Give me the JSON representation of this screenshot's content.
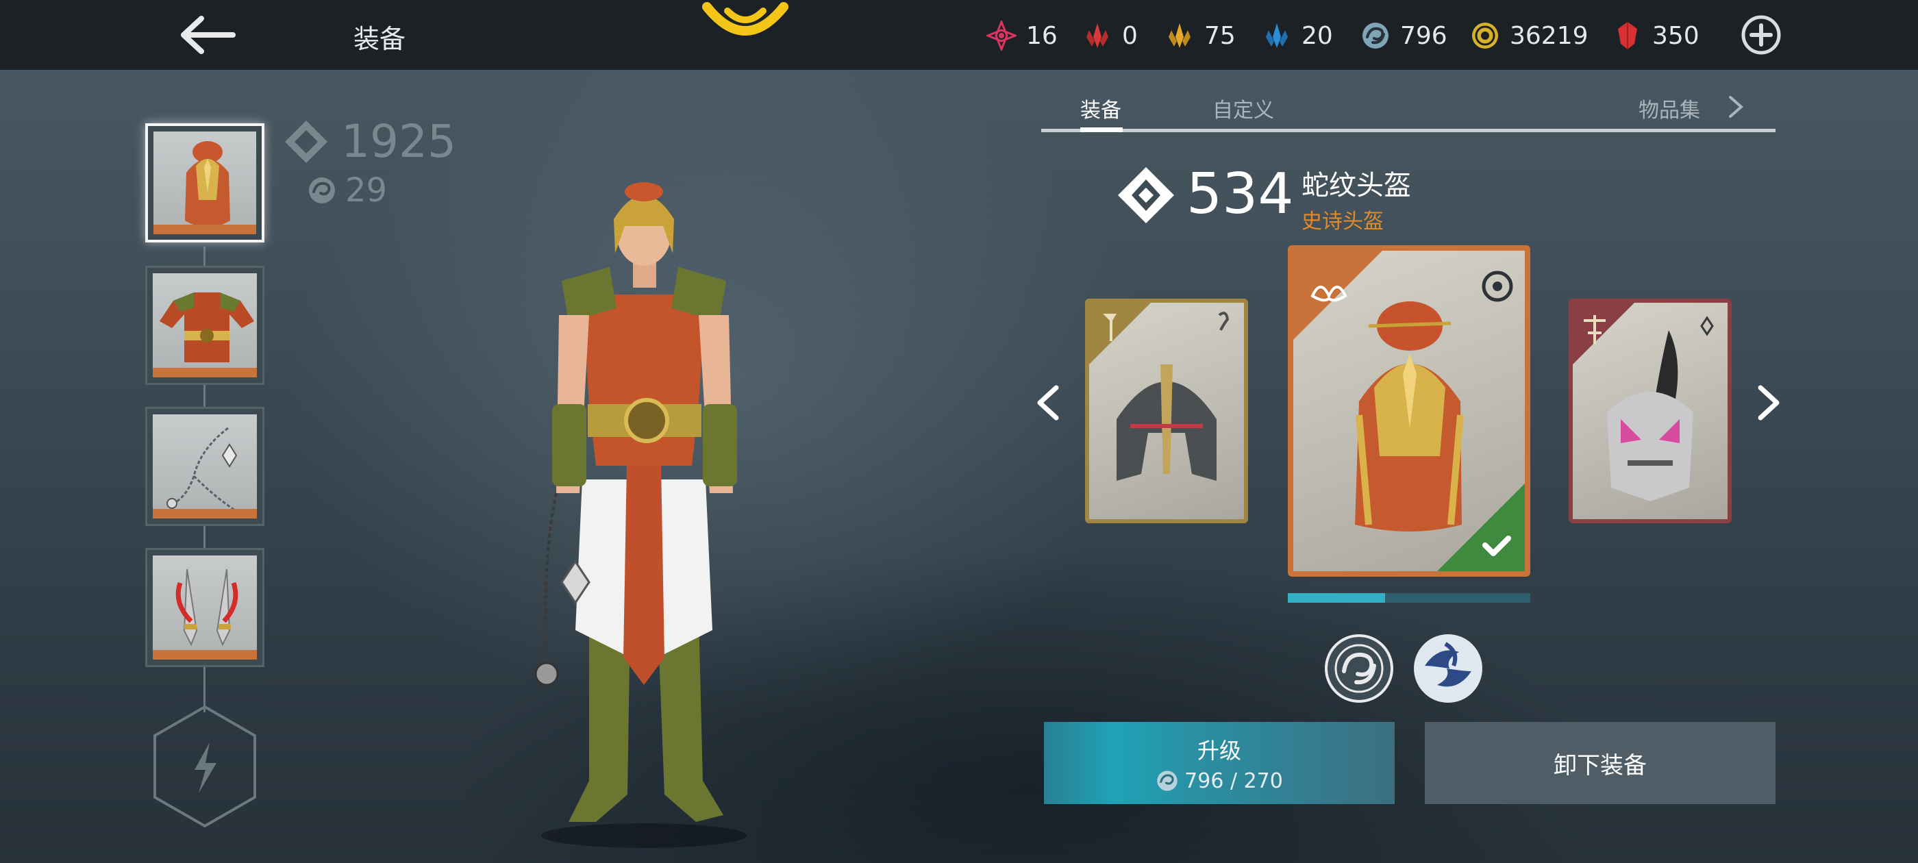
{
  "header": {
    "title": "装备",
    "currencies": [
      {
        "name": "pink-shard",
        "value": "16",
        "color": "#d8365e"
      },
      {
        "name": "red-crystal",
        "value": "0",
        "color": "#d83a3a"
      },
      {
        "name": "gold-crystal",
        "value": "75",
        "color": "#e2a92a"
      },
      {
        "name": "blue-crystal",
        "value": "20",
        "color": "#2a8fd8"
      },
      {
        "name": "swirl-orb",
        "value": "796",
        "color": "#9fc6d6"
      },
      {
        "name": "coin",
        "value": "36219",
        "color": "#d6b22a"
      },
      {
        "name": "ruby",
        "value": "350",
        "color": "#d63030"
      }
    ]
  },
  "character": {
    "power": "1925",
    "level": "29"
  },
  "slots": [
    {
      "name": "helmet",
      "selected": true
    },
    {
      "name": "armor",
      "selected": false
    },
    {
      "name": "chain-weapon",
      "selected": false
    },
    {
      "name": "daggers",
      "selected": false
    }
  ],
  "tabs": {
    "equip": "装备",
    "customize": "自定义",
    "collection": "物品集"
  },
  "item": {
    "power": "534",
    "name": "蛇纹头盔",
    "rarity": "史诗头盔",
    "upgrade_progress": 0.4
  },
  "actions": {
    "upgrade_label": "升级",
    "upgrade_cost": "796 / 270",
    "unequip_label": "卸下装备"
  },
  "colors": {
    "accent": "#33b0c4",
    "epic": "#e38a2a",
    "topbar": "#1c2126"
  }
}
